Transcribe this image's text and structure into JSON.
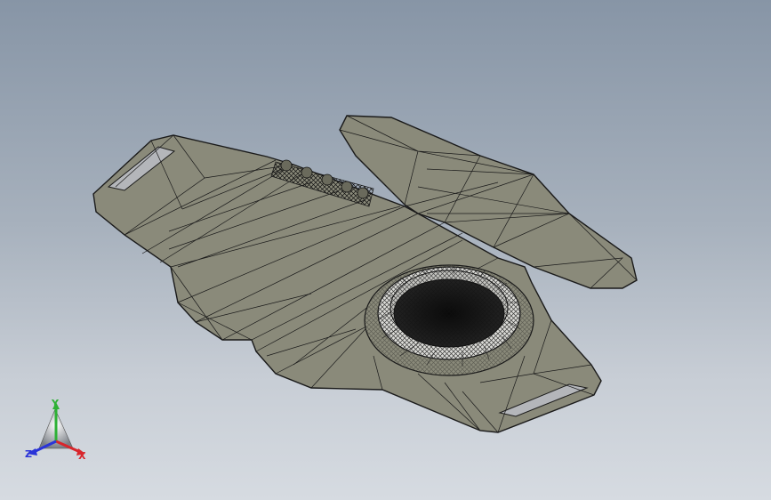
{
  "viewport": {
    "background_top": "#8795a6",
    "background_bottom": "#d6dbe1",
    "model_fill": "#8a8a7a",
    "model_edge": "#1a1a1a"
  },
  "triad": {
    "x_label": "X",
    "y_label": "Y",
    "z_label": "Z",
    "x_color": "#d8262c",
    "y_color": "#2eb135",
    "z_color": "#2a34d8"
  }
}
